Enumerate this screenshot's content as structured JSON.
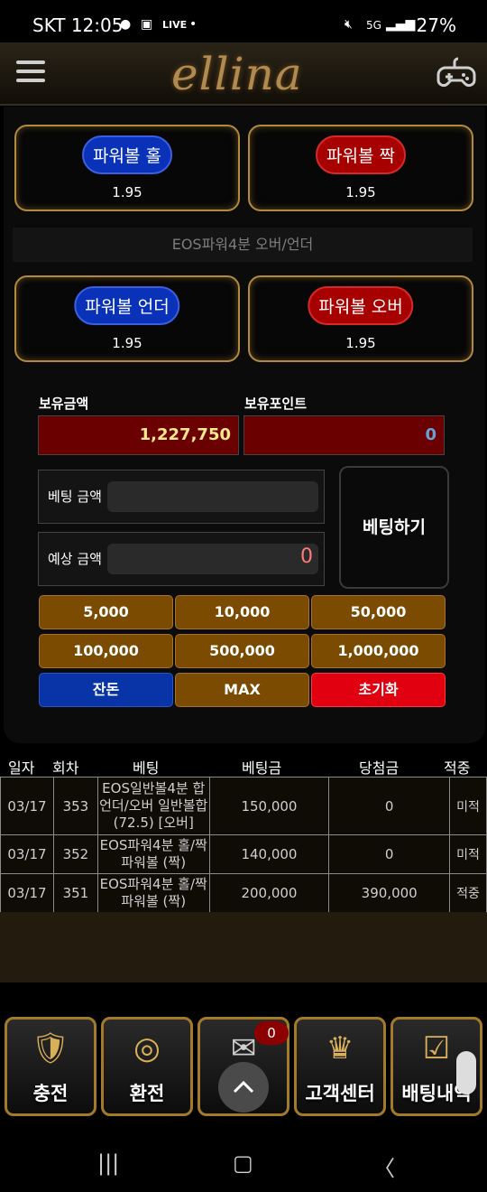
{
  "status_bar": {
    "carrier_time": "SKT 12:05",
    "battery": "27%"
  },
  "header": {
    "logo": "ellina"
  },
  "odds": [
    {
      "label": "파워볼 홀",
      "value": "1.95",
      "color": "#0a32b8"
    },
    {
      "label": "파워볼 짝",
      "value": "1.95",
      "color": "#a60000"
    },
    {
      "label": "파워볼 언더",
      "value": "1.95",
      "color": "#0a32b8"
    },
    {
      "label": "파워볼 오버",
      "value": "1.95",
      "color": "#a60000"
    }
  ],
  "section_title": "EOS파워4분 오버/언더",
  "balance": {
    "label": "보유금액",
    "value": "1,227,750"
  },
  "points": {
    "label": "보유포인트",
    "value": "0"
  },
  "bet": {
    "amount_label": "베팅 금액",
    "expected_label": "예상 금액",
    "expected_value": "0",
    "submit_label": "베팅하기"
  },
  "chips": [
    "5,000",
    "10,000",
    "50,000",
    "100,000",
    "500,000",
    "1,000,000"
  ],
  "actions": {
    "change": "잔돈",
    "max": "MAX",
    "reset": "초기화"
  },
  "history": {
    "headers": [
      "일자",
      "회차",
      "베팅",
      "베팅금",
      "당첨금",
      "적중"
    ],
    "rows": [
      {
        "date": "03/17",
        "round": "353",
        "bet": "EOS일반볼4분 합 언더/오버 일반볼합(72.5) [오버]",
        "amount": "150,000",
        "win": "0",
        "result": "미적"
      },
      {
        "date": "03/17",
        "round": "352",
        "bet": "EOS파워4분 홀/짝 파워볼 (짝)",
        "amount": "140,000",
        "win": "0",
        "result": "미적"
      },
      {
        "date": "03/17",
        "round": "351",
        "bet": "EOS파워4분 홀/짝 파워볼 (짝)",
        "amount": "200,000",
        "win": "390,000",
        "result": "적중"
      }
    ]
  },
  "tabs": [
    {
      "label": "충전",
      "icon": "shield-icon"
    },
    {
      "label": "환전",
      "icon": "coins-icon"
    },
    {
      "label": "",
      "icon": "mail-icon"
    },
    {
      "label": "고객센터",
      "icon": "crown-icon"
    },
    {
      "label": "배팅내역",
      "icon": "checklist-icon"
    }
  ],
  "mail_badge": "0"
}
